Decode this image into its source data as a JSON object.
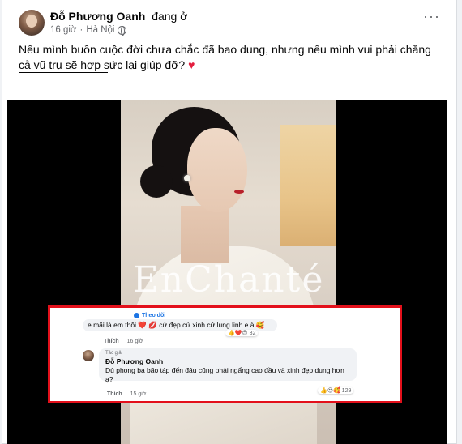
{
  "post": {
    "author": "Đỗ Phương Oanh",
    "status": "đang ở ",
    "time": "16 giờ",
    "location": "Hà Nội",
    "text": "Nếu mình buồn cuộc đời chưa chắc đã bao dung, nhưng nếu mình vui phải chăng cả vũ trụ sẽ hợp sức lại giúp đỡ?",
    "heart": "♥"
  },
  "photo": {
    "brand": "EnChanté"
  },
  "comments": {
    "first": {
      "follow_label": "Theo dõi",
      "text": "e mãi là em thôi ❤️ 💋 cứ đẹp cứ xinh cứ lung linh e à 🥰",
      "reactions": "👍❤️😍 32",
      "like": "Thích",
      "time": "16 giờ"
    },
    "reply": {
      "badge": "Tác giả",
      "author": "Đỗ Phương Oanh",
      "text": "Dù phong ba bão táp đến đâu cũng phải ngẩng cao đầu và xinh đẹp dung hơn ạ?",
      "reactions": "👍😍🥰 129",
      "like": "Thích",
      "time": "15 giờ"
    }
  },
  "colors": {
    "highlight": "#e3101b",
    "link": "#1b74e4",
    "heart": "#e41e3f"
  }
}
